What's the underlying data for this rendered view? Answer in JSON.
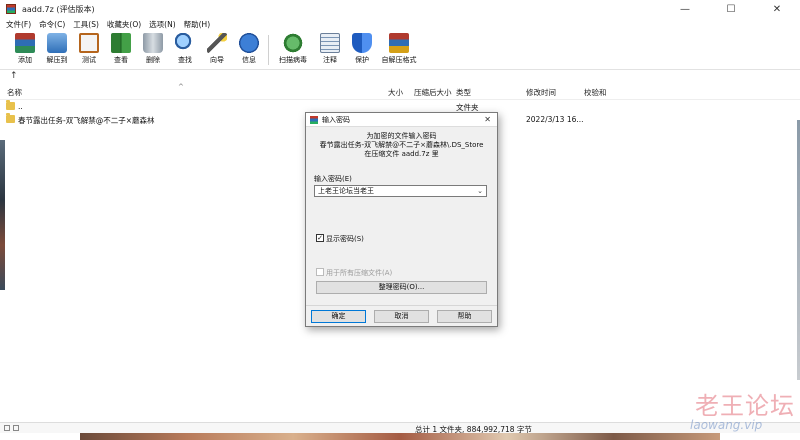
{
  "window": {
    "title": "aadd.7z (评估版本)",
    "controls": {
      "minimize": "—",
      "maximize": "☐",
      "close": "✕"
    }
  },
  "menu": [
    "文件(F)",
    "命令(C)",
    "工具(S)",
    "收藏夹(O)",
    "选项(N)",
    "帮助(H)"
  ],
  "toolbar": [
    {
      "label": "添加",
      "icon": "add-archive-icon"
    },
    {
      "label": "解压到",
      "icon": "extract-folder-icon"
    },
    {
      "label": "测试",
      "icon": "test-clipboard-icon"
    },
    {
      "label": "查看",
      "icon": "view-book-icon"
    },
    {
      "label": "删除",
      "icon": "trash-icon"
    },
    {
      "label": "查找",
      "icon": "magnifier-icon"
    },
    {
      "label": "向导",
      "icon": "wand-icon"
    },
    {
      "label": "信息",
      "icon": "info-icon"
    },
    {
      "label": "扫描病毒",
      "icon": "virus-scan-icon"
    },
    {
      "label": "注释",
      "icon": "comment-icon"
    },
    {
      "label": "保护",
      "icon": "shield-icon"
    },
    {
      "label": "自解压格式",
      "icon": "sfx-box-icon"
    }
  ],
  "address": {
    "up": "↑"
  },
  "columns": {
    "name": "名称",
    "size": "大小",
    "packed": "压缩后大小",
    "type": "类型",
    "modified": "修改时间",
    "crc": "校验和"
  },
  "files": [
    {
      "name": "..",
      "size": "",
      "packed": "",
      "type": "文件夹",
      "modified": "",
      "crc": ""
    },
    {
      "name": "春节露出任务-双飞解禁@不二子×蘑森林",
      "size": "",
      "packed": "",
      "type": "",
      "modified": "2022/3/13 16...",
      "crc": ""
    }
  ],
  "status": {
    "text": "总计 1 文件夹, 884,992,718 字节"
  },
  "dialog": {
    "title": "输入密码",
    "close": "✕",
    "info_line1": "为加密的文件输入密码",
    "info_line2": "春节露出任务-双飞解禁@不二子×蘑森林\\.DS_Store",
    "info_line3": "在压缩文件 aadd.7z 里",
    "password_label": "输入密码(E)",
    "password_value": "上老王论坛当老王",
    "show_password_label": "显示密码(S)",
    "show_password_checked": true,
    "use_all_label": "用于所有压缩文件(A)",
    "use_all_checked": false,
    "organize_button": "整理密码(O)...",
    "ok": "确定",
    "cancel": "取消",
    "help": "帮助"
  },
  "watermark": {
    "cn": "老王论坛",
    "en": "laowang.vip"
  },
  "colors": {
    "folder": "#e8c14c",
    "accent": "#0078d7",
    "watermark": "#e26e78"
  }
}
